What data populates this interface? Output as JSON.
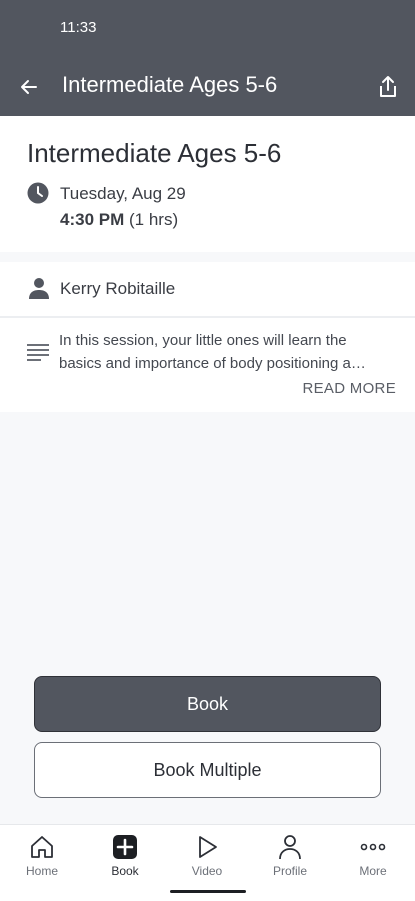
{
  "status_bar": {
    "time": "11:33"
  },
  "app_bar": {
    "title": "Intermediate Ages 5-6"
  },
  "class_info": {
    "title": "Intermediate Ages 5-6",
    "date": "Tuesday, Aug 29",
    "start_time": "4:30 PM",
    "duration": "(1 hrs)"
  },
  "instructor": {
    "name": "Kerry Robitaille"
  },
  "description": {
    "line1": "In this session, your little ones will learn the",
    "line2": "basics and importance of body positioning a…",
    "read_more": "READ MORE"
  },
  "actions": {
    "book_label": "Book",
    "book_multiple_label": "Book Multiple"
  },
  "nav": {
    "items": [
      {
        "label": "Home",
        "icon": "home-icon"
      },
      {
        "label": "Book",
        "icon": "book-plus-icon"
      },
      {
        "label": "Video",
        "icon": "play-icon"
      },
      {
        "label": "Profile",
        "icon": "person-icon"
      },
      {
        "label": "More",
        "icon": "more-icon"
      }
    ]
  },
  "colors": {
    "header": "#52565f",
    "primary_button": "#52565f"
  }
}
